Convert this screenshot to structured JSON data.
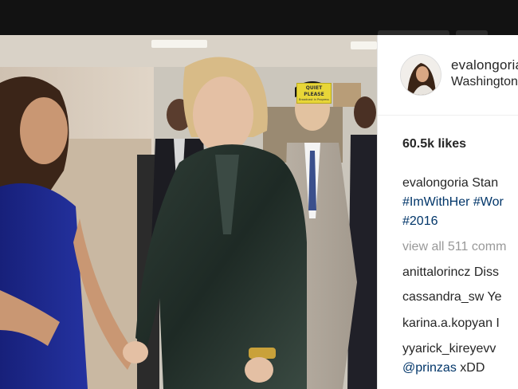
{
  "post": {
    "username": "evalongoria",
    "location": "Washington",
    "likes": "60.5k likes",
    "caption": {
      "author": "evalongoria",
      "text_start": "Stan",
      "hashtags_line1": [
        "#ImWithHer",
        "#Wor"
      ],
      "hashtags_line2": "#2016"
    },
    "view_all_comments": "view all 511 comm",
    "comments": [
      {
        "user": "anittalorincz",
        "text": "Diss"
      },
      {
        "user": "cassandra_sw",
        "text": "Ye"
      },
      {
        "user": "karina.a.kopyan",
        "text": "I"
      },
      {
        "user": "yyarick_kireyevv",
        "text": ""
      },
      {
        "user": "",
        "mention": "@prinzas",
        "text": "xDD"
      }
    ]
  },
  "photo": {
    "sign_title": "QUIET PLEASE",
    "sign_sub": "Broadcast in Progress"
  },
  "colors": {
    "top_bar": "#121212",
    "link": "#003569",
    "muted": "#999999",
    "text": "#262626"
  }
}
